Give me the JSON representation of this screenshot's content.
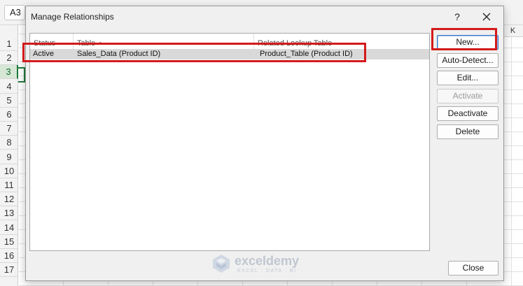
{
  "excel": {
    "name_box": "A3",
    "row_numbers": [
      "1",
      "2",
      "3",
      "4",
      "5",
      "6",
      "7",
      "8",
      "9",
      "10",
      "11",
      "12",
      "13",
      "14",
      "15",
      "16",
      "17"
    ],
    "active_row_index": 2,
    "column_letter": "K"
  },
  "dialog": {
    "title": "Manage Relationships",
    "help_glyph": "?",
    "columns": {
      "status": "Status",
      "table": "Table",
      "related": "Related Lookup Table"
    },
    "rows": [
      {
        "status": "Active",
        "table": "Sales_Data (Product ID)",
        "related": "Product_Table (Product ID)"
      }
    ],
    "buttons": {
      "new": "New...",
      "auto_detect": "Auto-Detect...",
      "edit": "Edit...",
      "activate": "Activate",
      "deactivate": "Deactivate",
      "delete": "Delete",
      "close": "Close"
    }
  },
  "watermark": {
    "name": "exceldemy",
    "tagline": "EXCEL · DATA · BI"
  },
  "colors": {
    "highlight": "#d41a1a",
    "accent": "#1e7b3c",
    "selected_row": "#d9d9d9"
  },
  "icons": [
    "close-icon",
    "sort-ascending-icon",
    "exceldemy-logo-icon"
  ]
}
